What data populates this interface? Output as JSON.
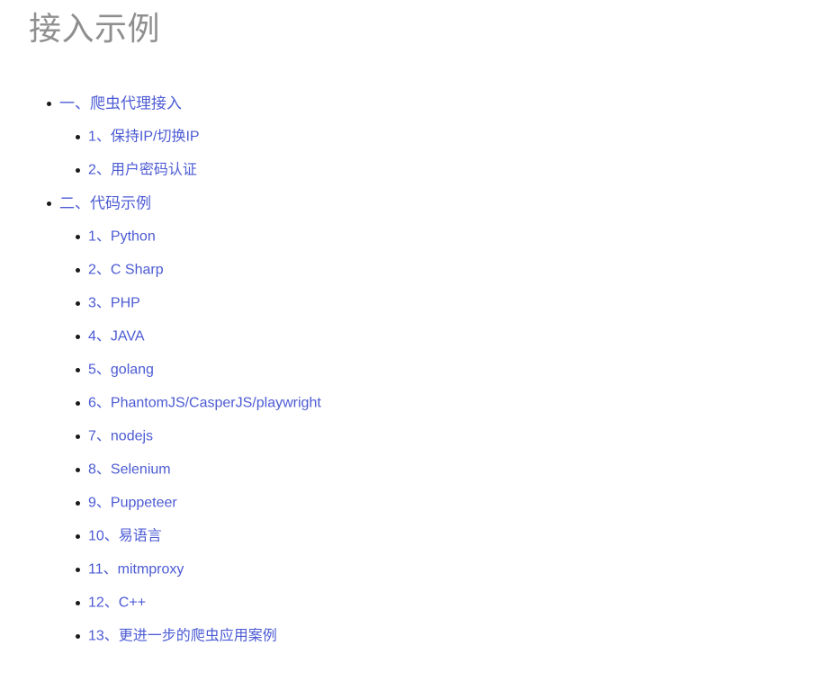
{
  "page": {
    "title": "接入示例",
    "background_color": "#ffffff",
    "title_color": "#8f8f8f",
    "link_color": "#4c5bd4",
    "bullet_color": "#1a1a1a"
  },
  "toc": {
    "sections": [
      {
        "label": "一、爬虫代理接入",
        "children": [
          {
            "label": "1、保持IP/切换IP"
          },
          {
            "label": "2、用户密码认证"
          }
        ]
      },
      {
        "label": "二、代码示例",
        "children": [
          {
            "label": "1、Python"
          },
          {
            "label": "2、C Sharp"
          },
          {
            "label": "3、PHP"
          },
          {
            "label": "4、JAVA"
          },
          {
            "label": "5、golang"
          },
          {
            "label": "6、PhantomJS/CasperJS/playwright"
          },
          {
            "label": "7、nodejs"
          },
          {
            "label": "8、Selenium"
          },
          {
            "label": "9、Puppeteer"
          },
          {
            "label": "10、易语言"
          },
          {
            "label": "11、mitmproxy"
          },
          {
            "label": "12、C++"
          },
          {
            "label": "13、更进一步的爬虫应用案例"
          }
        ]
      }
    ]
  }
}
